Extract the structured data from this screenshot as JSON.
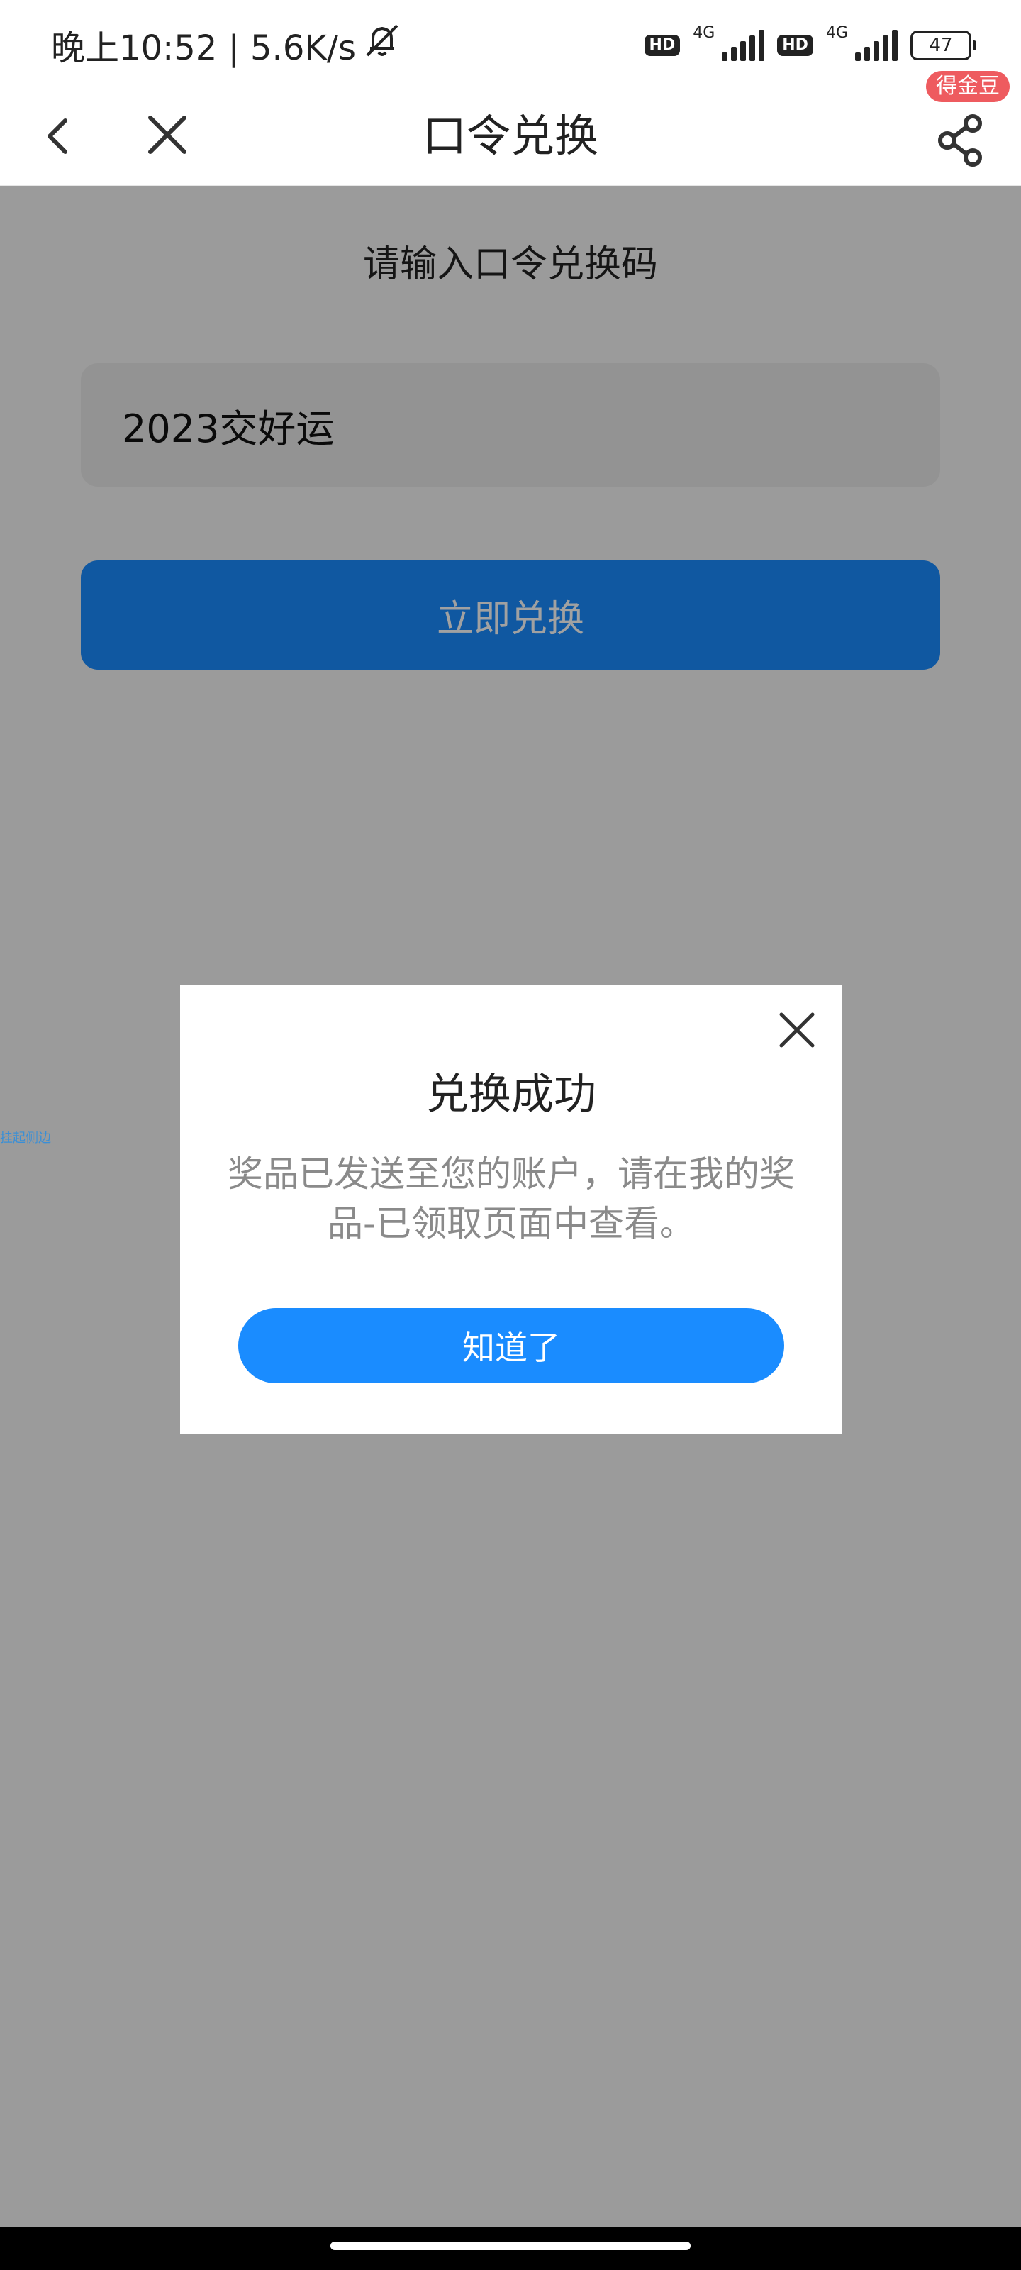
{
  "status_bar": {
    "time_speed": "晚上10:52 | 5.6K/s",
    "sim1_badge": "HD",
    "sim1_net": "4G",
    "sim2_badge": "HD",
    "sim2_net": "4G",
    "battery": "47",
    "icons": [
      "mute-icon",
      "signal-icon",
      "battery-icon"
    ]
  },
  "nav": {
    "title": "口令兑换",
    "badge": "得金豆",
    "icons": [
      "back-icon",
      "close-icon",
      "share-icon"
    ]
  },
  "form": {
    "label": "请输入口令兑换码",
    "code_value": "2023交好运",
    "redeem_button": "立即兑换"
  },
  "side_tag": "挂起侧边",
  "modal": {
    "title": "兑换成功",
    "message": "奖品已发送至您的账户，请在我的奖品-已领取页面中查看。",
    "ack_button": "知道了"
  },
  "colors": {
    "primary": "#1a8cff",
    "badge": "#ee5b5f",
    "mask": "rgba(0,0,0,0.37)"
  }
}
